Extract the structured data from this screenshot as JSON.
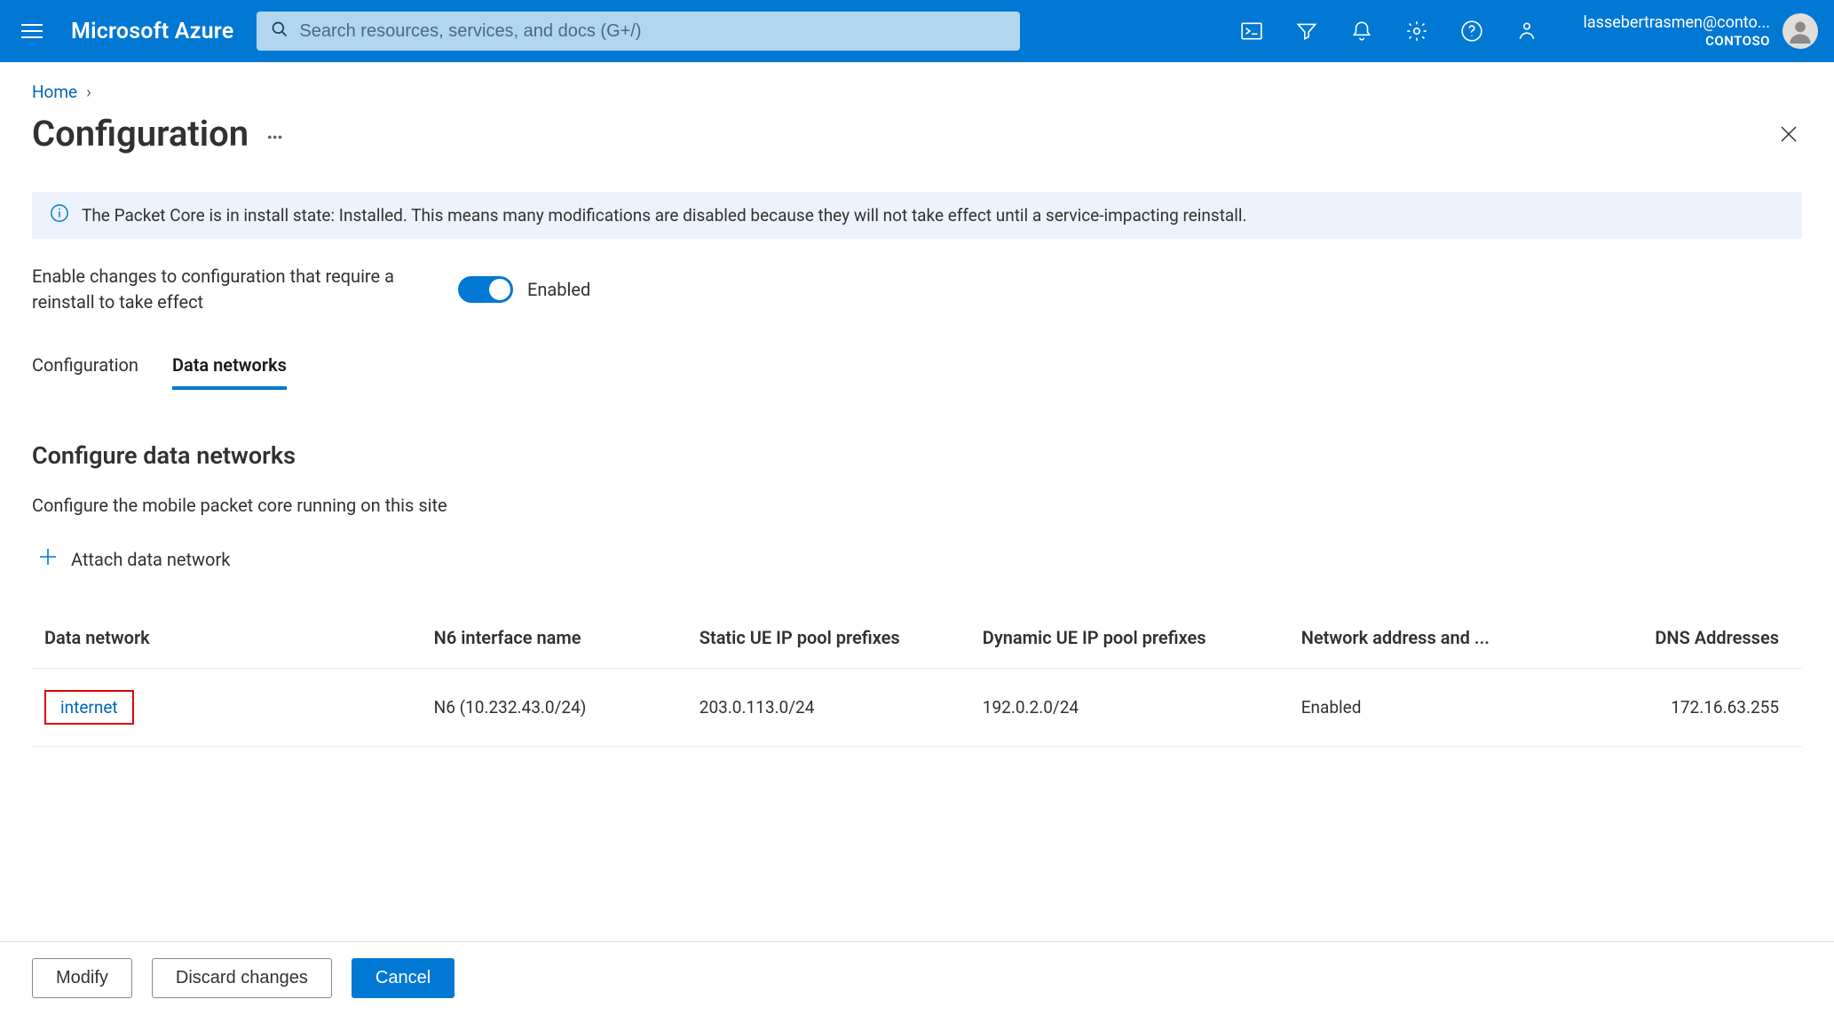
{
  "header": {
    "brand": "Microsoft Azure",
    "search_placeholder": "Search resources, services, and docs (G+/)",
    "account_email": "lassebertrasmen@conto...",
    "account_directory": "CONTOSO"
  },
  "breadcrumb": {
    "home": "Home"
  },
  "title": "Configuration",
  "banner": {
    "text": "The Packet Core is in install state: Installed. This means many modifications are disabled because they will not take effect until a service-impacting reinstall."
  },
  "toggle": {
    "label": "Enable changes to configuration that require a reinstall to take effect",
    "state_label": "Enabled",
    "enabled": true
  },
  "tabs": {
    "items": [
      {
        "label": "Configuration",
        "active": false
      },
      {
        "label": "Data networks",
        "active": true
      }
    ]
  },
  "section": {
    "title": "Configure data networks",
    "description": "Configure the mobile packet core running on this site",
    "attach_label": "Attach data network"
  },
  "table": {
    "columns": {
      "name": "Data network",
      "n6": "N6 interface name",
      "static": "Static UE IP pool prefixes",
      "dyn": "Dynamic UE IP pool prefixes",
      "nat": "Network address and ...",
      "dns": "DNS Addresses"
    },
    "rows": [
      {
        "name": "internet",
        "n6": "N6 (10.232.43.0/24)",
        "static": "203.0.113.0/24",
        "dyn": "192.0.2.0/24",
        "nat": "Enabled",
        "dns": "172.16.63.255"
      }
    ]
  },
  "footer": {
    "modify": "Modify",
    "discard": "Discard changes",
    "cancel": "Cancel"
  }
}
